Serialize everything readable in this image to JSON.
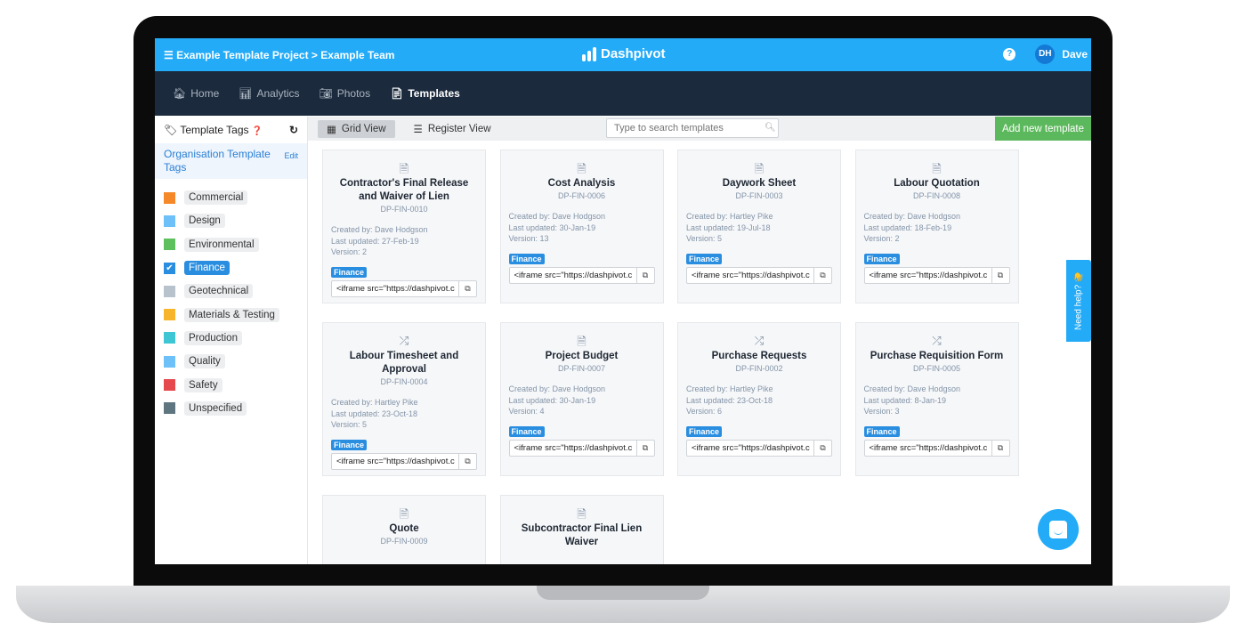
{
  "topbar": {
    "breadcrumb": "Example Template Project > Example Team",
    "brand": "Dashpivot",
    "avatar_initials": "DH",
    "user": "Dave"
  },
  "nav": [
    {
      "label": "Home",
      "icon": "home-icon"
    },
    {
      "label": "Analytics",
      "icon": "bar-chart-icon"
    },
    {
      "label": "Photos",
      "icon": "camera-icon"
    },
    {
      "label": "Templates",
      "icon": "document-icon",
      "active": true
    }
  ],
  "sidebar": {
    "title": "Template Tags",
    "org_label": "Organisation Template Tags",
    "edit": "Edit",
    "tags": [
      {
        "label": "Commercial",
        "color": "#f5892a"
      },
      {
        "label": "Design",
        "color": "#6ec1f8"
      },
      {
        "label": "Environmental",
        "color": "#5ec05c"
      },
      {
        "label": "Finance",
        "color": "#2a8ee0",
        "checked": true
      },
      {
        "label": "Geotechnical",
        "color": "#b8c2cc"
      },
      {
        "label": "Materials & Testing",
        "color": "#f6b52b"
      },
      {
        "label": "Production",
        "color": "#3ec6d4"
      },
      {
        "label": "Quality",
        "color": "#6ec1f8"
      },
      {
        "label": "Safety",
        "color": "#e5484d"
      },
      {
        "label": "Unspecified",
        "color": "#5f7580"
      }
    ]
  },
  "toolbar": {
    "grid_view": "Grid View",
    "register_view": "Register View",
    "search_placeholder": "Type to search templates",
    "add_button": "Add new template"
  },
  "cards": [
    {
      "icon": "document",
      "title": "Contractor's Final Release and Waiver of Lien",
      "code": "DP-FIN-0010",
      "created": "Created by: Dave Hodgson",
      "updated": "Last updated: 27-Feb-19",
      "version": "Version: 2",
      "tag": "Finance",
      "embed": "<iframe src=\"https://dashpivot.c"
    },
    {
      "icon": "document",
      "title": "Cost Analysis",
      "code": "DP-FIN-0006",
      "created": "Created by: Dave Hodgson",
      "updated": "Last updated: 30-Jan-19",
      "version": "Version: 13",
      "tag": "Finance",
      "embed": "<iframe src=\"https://dashpivot.c"
    },
    {
      "icon": "document",
      "title": "Daywork Sheet",
      "code": "DP-FIN-0003",
      "created": "Created by: Hartley Pike",
      "updated": "Last updated: 19-Jul-18",
      "version": "Version: 5",
      "tag": "Finance",
      "embed": "<iframe src=\"https://dashpivot.c"
    },
    {
      "icon": "document",
      "title": "Labour Quotation",
      "code": "DP-FIN-0008",
      "created": "Created by: Dave Hodgson",
      "updated": "Last updated: 18-Feb-19",
      "version": "Version: 2",
      "tag": "Finance",
      "embed": "<iframe src=\"https://dashpivot.c"
    },
    {
      "icon": "shuffle",
      "title": "Labour Timesheet and Approval",
      "code": "DP-FIN-0004",
      "created": "Created by: Hartley Pike",
      "updated": "Last updated: 23-Oct-18",
      "version": "Version: 5",
      "tag": "Finance",
      "embed": "<iframe src=\"https://dashpivot.c"
    },
    {
      "icon": "document",
      "title": "Project Budget",
      "code": "DP-FIN-0007",
      "created": "Created by: Dave Hodgson",
      "updated": "Last updated: 30-Jan-19",
      "version": "Version: 4",
      "tag": "Finance",
      "embed": "<iframe src=\"https://dashpivot.c"
    },
    {
      "icon": "shuffle",
      "title": "Purchase Requests",
      "code": "DP-FIN-0002",
      "created": "Created by: Hartley Pike",
      "updated": "Last updated: 23-Oct-18",
      "version": "Version: 6",
      "tag": "Finance",
      "embed": "<iframe src=\"https://dashpivot.c"
    },
    {
      "icon": "shuffle",
      "title": "Purchase Requisition Form",
      "code": "DP-FIN-0005",
      "created": "Created by: Dave Hodgson",
      "updated": "Last updated: 8-Jan-19",
      "version": "Version: 3",
      "tag": "Finance",
      "embed": "<iframe src=\"https://dashpivot.c"
    },
    {
      "icon": "document",
      "title": "Quote",
      "code": "DP-FIN-0009"
    },
    {
      "icon": "document",
      "title": "Subcontractor Final Lien Waiver"
    }
  ],
  "help_tab": "Need help? 👋",
  "colors": {
    "topbar": "#23abf8",
    "nav": "#1b2a3c",
    "accent": "#2a8ee0",
    "add_button": "#5cb85c"
  }
}
